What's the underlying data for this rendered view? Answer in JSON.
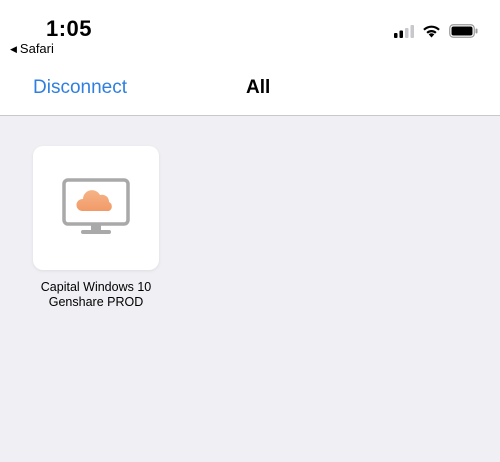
{
  "status_bar": {
    "time": "1:05",
    "back_app": "Safari",
    "back_icon": "back-triangle-icon",
    "icons": [
      "cellular-signal-icon",
      "wifi-icon",
      "battery-icon"
    ]
  },
  "nav": {
    "left_button": "Disconnect",
    "title": "All"
  },
  "colors": {
    "accent": "#2f7fe0",
    "background": "#efeff4",
    "cloud": "#f4a777",
    "monitor": "#a9a9a9"
  },
  "desktops": [
    {
      "icon": "monitor-cloud-icon",
      "name_line1": "Capital Windows 10",
      "name_line2": "Genshare PROD"
    }
  ]
}
